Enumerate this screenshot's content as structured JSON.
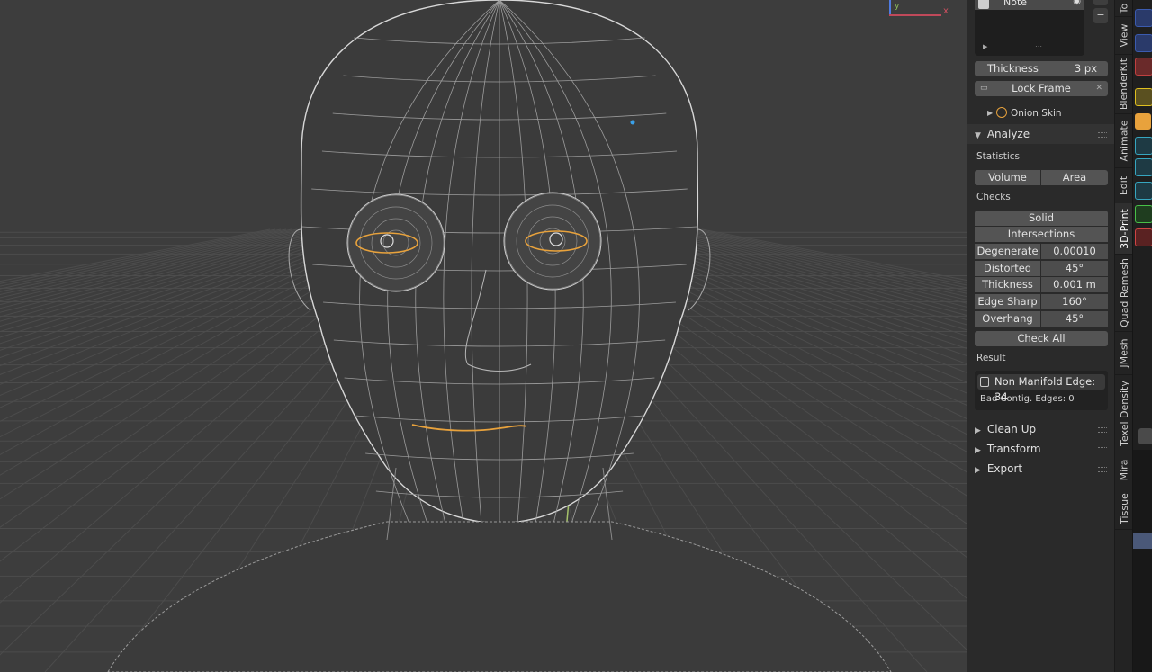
{
  "layers": {
    "note_label": "Note",
    "thickness_label": "Thickness",
    "thickness_value": "3 px",
    "lock_frame_label": "Lock Frame",
    "onion_skin_label": "Onion Skin"
  },
  "analyze": {
    "title": "Analyze",
    "statistics_label": "Statistics",
    "volume_label": "Volume",
    "area_label": "Area",
    "checks_label": "Checks",
    "solid_label": "Solid",
    "intersections_label": "Intersections",
    "checks": [
      {
        "label": "Degenerate",
        "value": "0.00010"
      },
      {
        "label": "Distorted",
        "value": "45°"
      },
      {
        "label": "Thickness",
        "value": "0.001 m"
      },
      {
        "label": "Edge Sharp",
        "value": "160°"
      },
      {
        "label": "Overhang",
        "value": "45°"
      }
    ],
    "check_all_label": "Check All",
    "result_label": "Result",
    "result_line1": "Non Manifold Edge: 34",
    "result_line2": "Bad Contig. Edges: 0"
  },
  "sections": {
    "cleanup": "Clean Up",
    "transform": "Transform",
    "export": "Export"
  },
  "gizmo": {
    "y": "y",
    "x": "x"
  },
  "tabs": [
    "To",
    "View",
    "BlenderKit",
    "Animate",
    "Edit",
    "3D-Print",
    "Quad Remesh",
    "JMesh",
    "Texel Density",
    "Mira",
    "Tissue"
  ],
  "colors": {
    "accent_orange": "#e8a23c",
    "viewport_bg": "#3d3d3d",
    "panel_bg": "#2a2a2a",
    "button_bg": "#545454"
  }
}
